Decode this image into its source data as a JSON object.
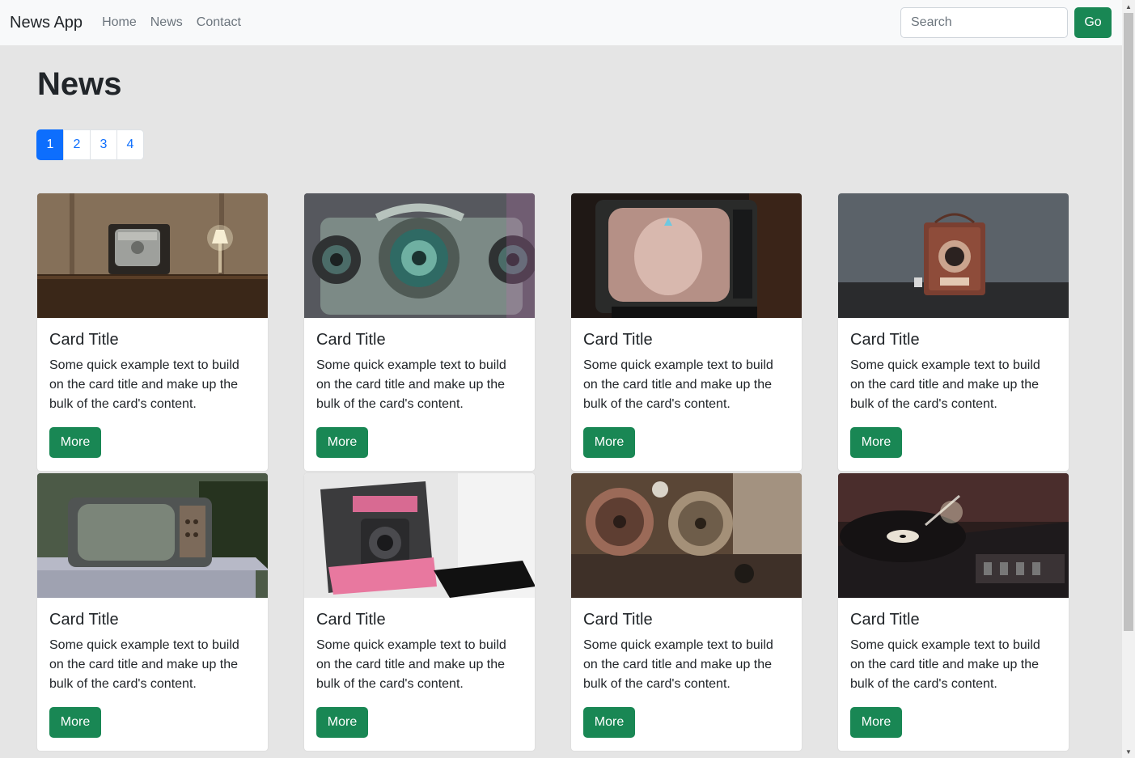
{
  "navbar": {
    "brand": "News App",
    "links": [
      "Home",
      "News",
      "Contact"
    ],
    "search_placeholder": "Search",
    "go_label": "Go"
  },
  "page": {
    "title": "News",
    "pagination": [
      "1",
      "2",
      "3",
      "4"
    ],
    "active_page": "1"
  },
  "cards": [
    {
      "title": "Card Title",
      "text": "Some quick example text to build on the card title and make up the bulk of the card's content.",
      "button": "More",
      "image": "vintage-tv-room"
    },
    {
      "title": "Card Title",
      "text": "Some quick example text to build on the card title and make up the bulk of the card's content.",
      "button": "More",
      "image": "green-ray-projector"
    },
    {
      "title": "Card Title",
      "text": "Some quick example text to build on the card title and make up the bulk of the card's content.",
      "button": "More",
      "image": "old-crt-tv"
    },
    {
      "title": "Card Title",
      "text": "Some quick example text to build on the card title and make up the bulk of the card's content.",
      "button": "More",
      "image": "box-camera"
    },
    {
      "title": "Card Title",
      "text": "Some quick example text to build on the card title and make up the bulk of the card's content.",
      "button": "More",
      "image": "abandoned-tv"
    },
    {
      "title": "Card Title",
      "text": "Some quick example text to build on the card title and make up the bulk of the card's content.",
      "button": "More",
      "image": "polaroid-camera"
    },
    {
      "title": "Card Title",
      "text": "Some quick example text to build on the card title and make up the bulk of the card's content.",
      "button": "More",
      "image": "film-reels"
    },
    {
      "title": "Card Title",
      "text": "Some quick example text to build on the card title and make up the bulk of the card's content.",
      "button": "More",
      "image": "record-player"
    }
  ],
  "colors": {
    "primary": "#0d6efd",
    "success": "#198754",
    "navbar_bg": "#f8f9fa",
    "page_bg": "#e5e5e5"
  }
}
